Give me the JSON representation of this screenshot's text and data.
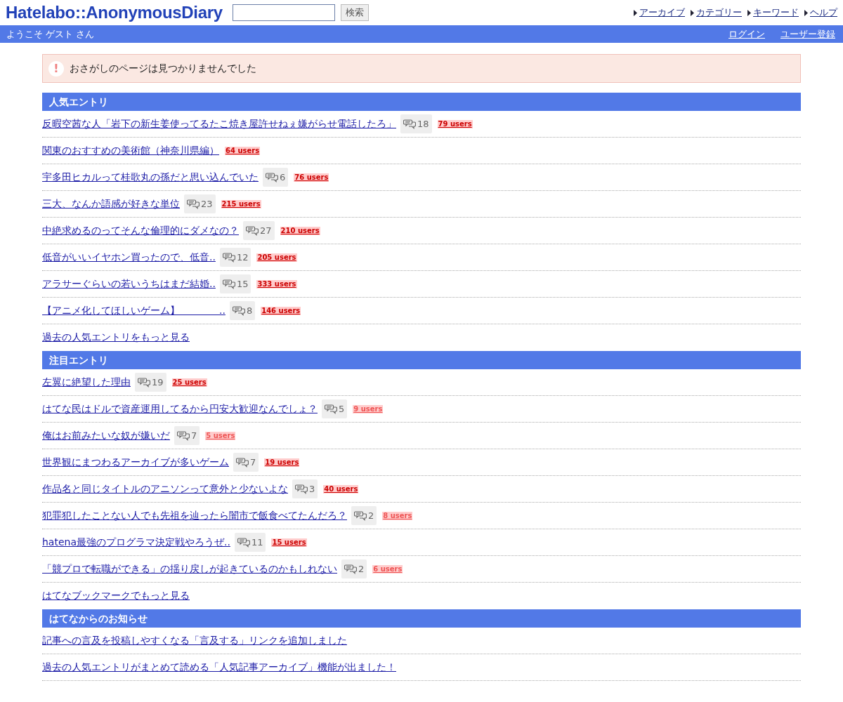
{
  "header": {
    "logo": "Hatelabo::AnonymousDiary",
    "search": {
      "button": "検索"
    },
    "nav": [
      "アーカイブ",
      "カテゴリー",
      "キーワード",
      "ヘルプ"
    ]
  },
  "user_bar": {
    "welcome": "ようこそ ゲスト さん",
    "links": [
      "ログイン",
      "ユーザー登録"
    ]
  },
  "alert": {
    "icon": "!",
    "message": "おさがしのページは見つかりませんでした"
  },
  "sections": [
    {
      "title": "人気エントリ",
      "entries": [
        {
          "title": "反暇空茜な人「岩下の新生姜使ってるたこ焼き屋許せねぇ嫌がらせ電話したろ」",
          "comments": "18",
          "users": "79 users",
          "color": "#cc0000"
        },
        {
          "title": "関東のおすすめの美術館（神奈川県編）",
          "users": "64 users",
          "color": "#cc0000"
        },
        {
          "title": "宇多田ヒカルって桂歌丸の孫だと思い込んでいた",
          "comments": "6",
          "users": "76 users",
          "color": "#cc0000"
        },
        {
          "title": "三大、なんか語感が好きな単位",
          "comments": "23",
          "users": "215 users",
          "color": "#cc0000"
        },
        {
          "title": "中絶求めるのってそんな倫理的にダメなの？",
          "comments": "27",
          "users": "210 users",
          "color": "#cc0000"
        },
        {
          "title": "低音がいいイヤホン買ったので、低音..",
          "comments": "12",
          "users": "205 users",
          "color": "#cc0000"
        },
        {
          "title": "アラサーぐらいの若いうちはまだ結婚..",
          "comments": "15",
          "users": "333 users",
          "color": "#cc0000"
        },
        {
          "title": "【アニメ化してほしいゲーム】　　　　..",
          "comments": "8",
          "users": "146 users",
          "color": "#cc0000"
        }
      ],
      "more": "過去の人気エントリをもっと見る"
    },
    {
      "title": "注目エントリ",
      "entries": [
        {
          "title": "左翼に絶望した理由",
          "comments": "19",
          "users": "25 users",
          "color": "#cc0000"
        },
        {
          "title": "はてな民はドルで資産運用してるから円安大歓迎なんでしょ？",
          "comments": "5",
          "users": "9 users",
          "color": "#ee5555"
        },
        {
          "title": "俺はお前みたいな奴が嫌いだ",
          "comments": "7",
          "users": "5 users",
          "color": "#ee5555"
        },
        {
          "title": "世界観にまつわるアーカイブが多いゲーム",
          "comments": "7",
          "users": "19 users",
          "color": "#cc0000"
        },
        {
          "title": "作品名と同じタイトルのアニソンって意外と少ないよな",
          "comments": "3",
          "users": "40 users",
          "color": "#cc0000"
        },
        {
          "title": "犯罪犯したことない人でも先祖を辿ったら闇市で飯食べてたんだろ？",
          "comments": "2",
          "users": "8 users",
          "color": "#ee5555"
        },
        {
          "title": "hatena最強のプログラマ決定戦やろうぜ..",
          "comments": "11",
          "users": "15 users",
          "color": "#cc0000"
        },
        {
          "title": "「競プロで転職ができる」の揺り戻しが起きているのかもしれない",
          "comments": "2",
          "users": "6 users",
          "color": "#ee5555"
        }
      ],
      "more": "はてなブックマークでもっと見る"
    },
    {
      "title": "はてなからのお知らせ",
      "entries": [
        {
          "title": "記事への言及を投稿しやすくなる「言及する」リンクを追加しました"
        },
        {
          "title": "過去の人気エントリがまとめて読める「人気記事アーカイブ」機能が出ました！"
        }
      ]
    }
  ]
}
